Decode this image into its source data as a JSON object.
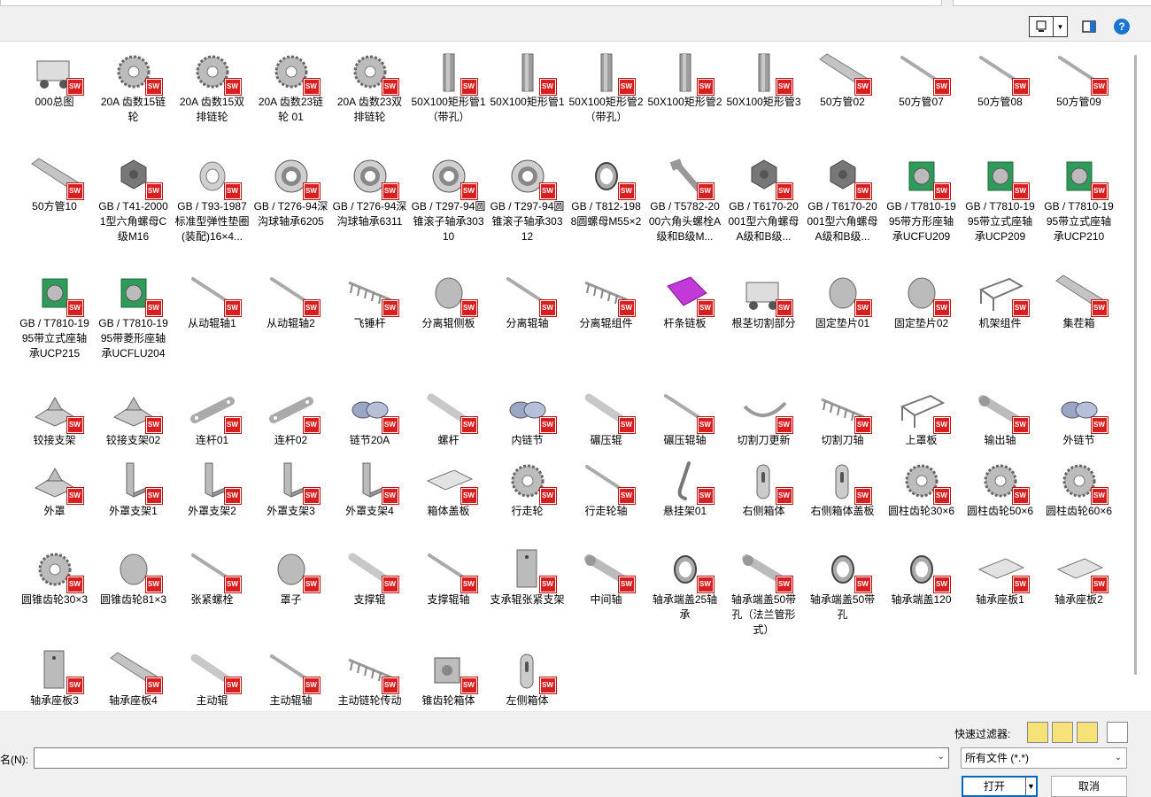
{
  "items": [
    {
      "name": "000总图",
      "kind": "assembly"
    },
    {
      "name": "20A 齿数15链轮",
      "kind": "gear"
    },
    {
      "name": "20A 齿数15双排链轮",
      "kind": "gear"
    },
    {
      "name": "20A 齿数23链轮 01",
      "kind": "gear"
    },
    {
      "name": "20A 齿数23双排链轮",
      "kind": "gear"
    },
    {
      "name": "50X100矩形管1（带孔）",
      "kind": "tube"
    },
    {
      "name": "50X100矩形管1",
      "kind": "tube"
    },
    {
      "name": "50X100矩形管2（带孔）",
      "kind": "tube"
    },
    {
      "name": "50X100矩形管2",
      "kind": "tube"
    },
    {
      "name": "50X100矩形管3",
      "kind": "tube"
    },
    {
      "name": "50方管02",
      "kind": "bar"
    },
    {
      "name": "50方管07",
      "kind": "rod"
    },
    {
      "name": "50方管08",
      "kind": "rod"
    },
    {
      "name": "50方管09",
      "kind": "rod"
    },
    {
      "name": "50方管10",
      "kind": "bar"
    },
    {
      "name": "GB / T41-20001型六角螺母C级M16",
      "kind": "nut"
    },
    {
      "name": "GB / T93-1987标准型弹性垫圈(装配)16×4...",
      "kind": "washer"
    },
    {
      "name": "GB / T276-94深沟球轴承6205",
      "kind": "bearing"
    },
    {
      "name": "GB / T276-94深沟球轴承6311",
      "kind": "bearing"
    },
    {
      "name": "GB / T297-94圆锥滚子轴承30310",
      "kind": "bearing"
    },
    {
      "name": "GB / T297-94圆锥滚子轴承30312",
      "kind": "bearing"
    },
    {
      "name": "GB / T812-1988圆螺母M55×2",
      "kind": "ring"
    },
    {
      "name": "GB / T5782-2000六角头螺栓A级和B级M...",
      "kind": "bolt"
    },
    {
      "name": "GB / T6170-20001型六角螺母A级和B级...",
      "kind": "nut"
    },
    {
      "name": "GB / T6170-20001型六角螺母A级和B级...",
      "kind": "nut"
    },
    {
      "name": "GB / T7810-1995带方形座轴承UCFU209",
      "kind": "green"
    },
    {
      "name": "GB / T7810-1995带立式座轴承UCP209",
      "kind": "green"
    },
    {
      "name": "GB / T7810-1995带立式座轴承UCP210",
      "kind": "green"
    },
    {
      "name": "GB / T7810-1995带立式座轴承UCP215",
      "kind": "green"
    },
    {
      "name": "GB / T7810-1995带菱形座轴承UCFLU204",
      "kind": "green"
    },
    {
      "name": "从动辊轴1",
      "kind": "rod"
    },
    {
      "name": "从动辊轴2",
      "kind": "rod"
    },
    {
      "name": "飞锤杆",
      "kind": "comb"
    },
    {
      "name": "分离辊侧板",
      "kind": "disc"
    },
    {
      "name": "分离辊轴",
      "kind": "rod"
    },
    {
      "name": "分离辊组件",
      "kind": "comb"
    },
    {
      "name": "杆条链板",
      "kind": "purple"
    },
    {
      "name": "根茎切割部分",
      "kind": "assembly"
    },
    {
      "name": "固定垫片01",
      "kind": "disc"
    },
    {
      "name": "固定垫片02",
      "kind": "disc"
    },
    {
      "name": "机架组件",
      "kind": "frame"
    },
    {
      "name": "集茬箱",
      "kind": "bar"
    },
    {
      "name": "铰接支架",
      "kind": "bracket"
    },
    {
      "name": "铰接支架02",
      "kind": "bracket"
    },
    {
      "name": "连杆01",
      "kind": "link"
    },
    {
      "name": "连杆02",
      "kind": "link"
    },
    {
      "name": "链节20A",
      "kind": "chain"
    },
    {
      "name": "螺杆",
      "kind": "roller"
    },
    {
      "name": "内链节",
      "kind": "chain"
    },
    {
      "name": "碾压辊",
      "kind": "roller"
    },
    {
      "name": "碾压辊轴",
      "kind": "rod"
    },
    {
      "name": "切割刀更新",
      "kind": "arc"
    },
    {
      "name": "切割刀轴",
      "kind": "comb"
    },
    {
      "name": "上罩板",
      "kind": "frame"
    },
    {
      "name": "输出轴",
      "kind": "shaft"
    },
    {
      "name": "外链节",
      "kind": "chain"
    },
    {
      "name": "外罩",
      "kind": "bracket"
    },
    {
      "name": "外罩支架1",
      "kind": "angle"
    },
    {
      "name": "外罩支架2",
      "kind": "angle"
    },
    {
      "name": "外罩支架3",
      "kind": "angle"
    },
    {
      "name": "外罩支架4",
      "kind": "angle"
    },
    {
      "name": "箱体盖板",
      "kind": "plate"
    },
    {
      "name": "行走轮",
      "kind": "gear"
    },
    {
      "name": "行走轮轴",
      "kind": "rod"
    },
    {
      "name": "悬挂架01",
      "kind": "hook"
    },
    {
      "name": "右侧箱体",
      "kind": "slot"
    },
    {
      "name": "右侧箱体盖板",
      "kind": "slot"
    },
    {
      "name": "圆柱齿轮30×6",
      "kind": "gear"
    },
    {
      "name": "圆柱齿轮50×6",
      "kind": "gear"
    },
    {
      "name": "圆柱齿轮60×6",
      "kind": "gear"
    },
    {
      "name": "圆锥齿轮30×3",
      "kind": "gear"
    },
    {
      "name": "圆锥齿轮81×3",
      "kind": "disc"
    },
    {
      "name": "张紧螺栓",
      "kind": "rod"
    },
    {
      "name": "罩子",
      "kind": "disc"
    },
    {
      "name": "支撑辊",
      "kind": "roller"
    },
    {
      "name": "支撑辊轴",
      "kind": "rod"
    },
    {
      "name": "支承辊张紧支架",
      "kind": "plate-v"
    },
    {
      "name": "中间轴",
      "kind": "shaft"
    },
    {
      "name": "轴承端盖25轴承",
      "kind": "ring"
    },
    {
      "name": "轴承端盖50带孔（法兰管形式）",
      "kind": "shaft"
    },
    {
      "name": "轴承端盖50带孔",
      "kind": "ring"
    },
    {
      "name": "轴承端盖120",
      "kind": "ring"
    },
    {
      "name": "轴承座板1",
      "kind": "plate"
    },
    {
      "name": "轴承座板2",
      "kind": "plate"
    },
    {
      "name": "轴承座板3",
      "kind": "plate-v"
    },
    {
      "name": "轴承座板4",
      "kind": "bar"
    },
    {
      "name": "主动辊",
      "kind": "roller"
    },
    {
      "name": "主动辊轴",
      "kind": "rod"
    },
    {
      "name": "主动链轮传动",
      "kind": "comb"
    },
    {
      "name": "锥齿轮箱体",
      "kind": "box"
    },
    {
      "name": "左侧箱体",
      "kind": "slot"
    }
  ],
  "badge_text": "SW",
  "bottom": {
    "quick_filter_label": "快速过滤器:",
    "name_label": "名(N):",
    "name_value": "",
    "file_type": "所有文件 (*.*)",
    "open_label": "打开",
    "cancel_label": "取消"
  },
  "toolbar": {
    "help_glyph": "?"
  }
}
